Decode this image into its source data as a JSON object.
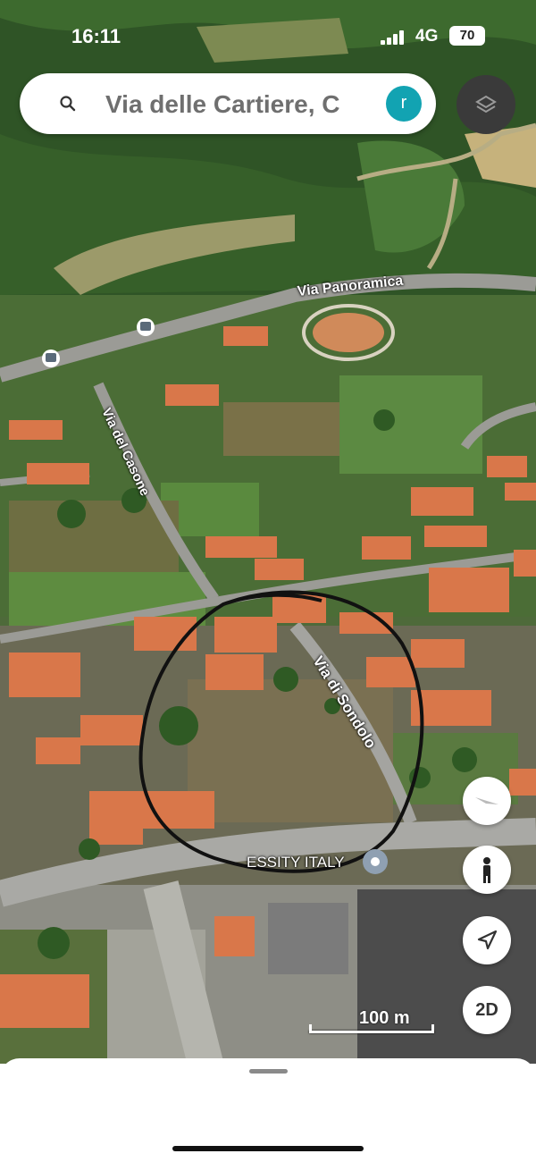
{
  "status_bar": {
    "time": "16:11",
    "network": "4G",
    "battery": "70"
  },
  "search": {
    "query": "Via delle Cartiere, C",
    "avatar_letter": "r",
    "icon": "search-icon"
  },
  "map": {
    "view": "satellite",
    "street_labels": [
      {
        "text": "Via Panoramica"
      },
      {
        "text": "Via del Casone"
      },
      {
        "text": "Via di Sondolo"
      }
    ],
    "place_label": "ESSITY ITALY",
    "scale_label": "100 m",
    "annotation": "hand-drawn circle"
  },
  "controls": {
    "layers_icon": "layers-icon",
    "compass_icon": "compass-icon",
    "street_view_icon": "pegman-icon",
    "locate_icon": "navigation-arrow-icon",
    "view_toggle_label": "2D"
  },
  "colors": {
    "accent": "#12a3b2",
    "roof": "#d9774a",
    "vegetation": "#3f6b2e",
    "road": "#9a9a9a"
  }
}
